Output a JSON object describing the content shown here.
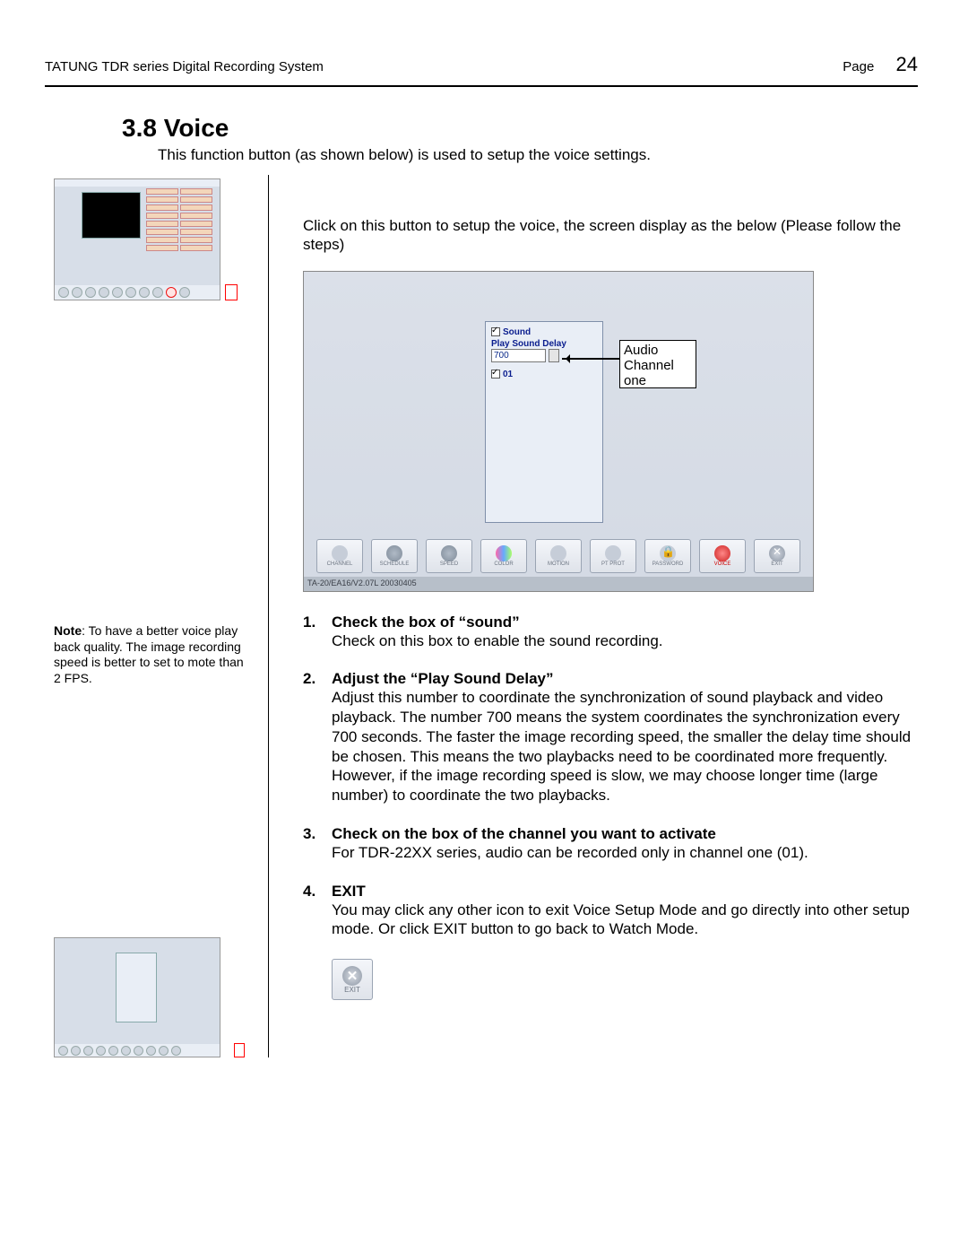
{
  "header": {
    "title": "TATUNG TDR series Digital Recording System",
    "page_label": "Page",
    "page_number": "24"
  },
  "section": {
    "number": "3.8",
    "title": "Voice",
    "lead": "This function button (as shown below) is used to setup the voice settings."
  },
  "right_intro": "Click on this button to setup the voice, the screen display as the below (Please follow the steps)",
  "sidebar_note": {
    "label": "Note",
    "text": ": To have a better voice play back quality. The image recording speed is better to set to mote than 2 FPS."
  },
  "bigshot": {
    "panel": {
      "sound_label": "Sound",
      "sound_checked": true,
      "delay_label": "Play Sound Delay",
      "delay_value": "700",
      "ch01_label": "01",
      "ch01_checked": true
    },
    "callout": "Audio Channel one",
    "toolbar": [
      {
        "name": "channel",
        "label": "CHANNEL",
        "icon": "ic-channel"
      },
      {
        "name": "schedule",
        "label": "SCHEDULE",
        "icon": "ic-schedule"
      },
      {
        "name": "speed",
        "label": "SPEED",
        "icon": "ic-speed"
      },
      {
        "name": "color",
        "label": "COLOR",
        "icon": "ic-color"
      },
      {
        "name": "motion",
        "label": "MOTION",
        "icon": "ic-motion"
      },
      {
        "name": "ptz",
        "label": "PT PROT",
        "icon": "ic-ptz"
      },
      {
        "name": "password",
        "label": "PASSWORD",
        "icon": "ic-pass"
      },
      {
        "name": "voice",
        "label": "VOICE",
        "icon": "ic-voice",
        "active": true
      },
      {
        "name": "exit",
        "label": "EXIT",
        "icon": "ic-exit"
      }
    ],
    "status": "TA-20/EA16/V2.07L 20030405"
  },
  "steps": [
    {
      "num": "1.",
      "title": "Check the box of “sound”",
      "body": "Check on this box to enable the sound recording."
    },
    {
      "num": "2.",
      "title": "Adjust the “Play Sound Delay”",
      "body": "Adjust this number to coordinate the synchronization of sound playback and video playback. The number 700 means the system coordinates the synchronization every 700 seconds. The faster the image recording speed, the smaller the delay time should be chosen. This means the two playbacks need to be coordinated more frequently. However, if the image recording speed is slow, we may choose longer time (large number) to coordinate the two playbacks."
    },
    {
      "num": "3.",
      "title": "Check on the box of the channel you want to activate",
      "body": "For TDR-22XX series, audio can be recorded only in channel one (01)."
    },
    {
      "num": "4.",
      "title": "EXIT",
      "body": "You may click any other icon to exit Voice Setup Mode and go directly into other setup mode. Or click EXIT button to go back to Watch Mode."
    }
  ],
  "exit_icon_label": "EXIT"
}
